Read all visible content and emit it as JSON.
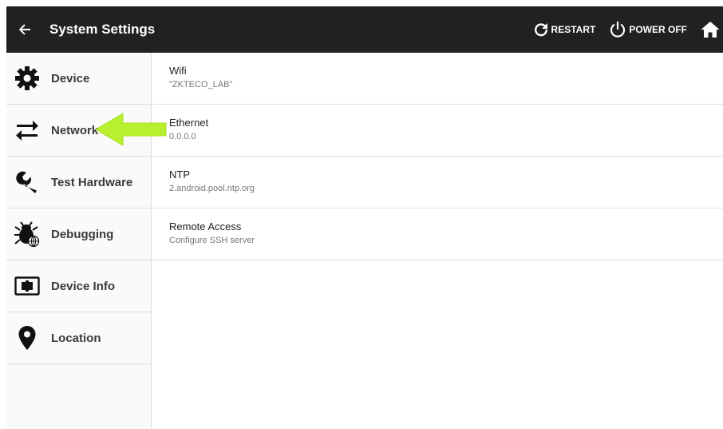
{
  "header": {
    "title": "System Settings",
    "restart_label": "RESTART",
    "power_off_label": "POWER OFF"
  },
  "sidebar": {
    "items": [
      {
        "label": "Device",
        "icon": "gear-icon"
      },
      {
        "label": "Network",
        "icon": "swap-arrows-icon"
      },
      {
        "label": "Test Hardware",
        "icon": "wrench-icon"
      },
      {
        "label": "Debugging",
        "icon": "bug-icon"
      },
      {
        "label": "Device Info",
        "icon": "device-info-icon"
      },
      {
        "label": "Location",
        "icon": "location-pin-icon"
      }
    ]
  },
  "main": {
    "rows": [
      {
        "title": "Wifi",
        "subtitle": "\"ZKTECO_LAB\""
      },
      {
        "title": "Ethernet",
        "subtitle": "0.0.0.0"
      },
      {
        "title": "NTP",
        "subtitle": "2.android.pool.ntp.org"
      },
      {
        "title": "Remote Access",
        "subtitle": "Configure SSH server"
      }
    ]
  },
  "colors": {
    "topbar": "#212121",
    "annotation_arrow": "#b8ef2e"
  }
}
